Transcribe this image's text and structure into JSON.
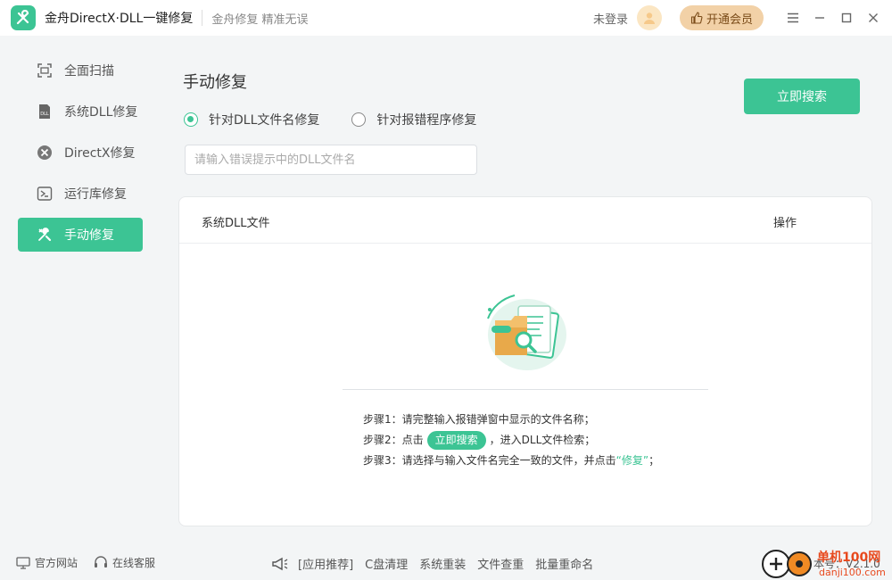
{
  "app": {
    "title": "金舟DirectX·DLL一键修复",
    "slogan": "金舟修复 精准无误",
    "login": "未登录",
    "vip": "开通会员"
  },
  "sidebar": {
    "items": [
      {
        "label": "全面扫描",
        "icon": "scan-icon"
      },
      {
        "label": "系统DLL修复",
        "icon": "dll-icon"
      },
      {
        "label": "DirectX修复",
        "icon": "directx-icon"
      },
      {
        "label": "运行库修复",
        "icon": "runtime-icon"
      },
      {
        "label": "手动修复",
        "icon": "wrench-icon",
        "active": true
      }
    ]
  },
  "main": {
    "title": "手动修复",
    "radio_by_name": "针对DLL文件名修复",
    "radio_by_program": "针对报错程序修复",
    "search_placeholder": "请输入错误提示中的DLL文件名",
    "search_button": "立即搜索",
    "table": {
      "col_file": "系统DLL文件",
      "col_op": "操作"
    },
    "steps": {
      "step1": "步骤1：请完整输入报错弹窗中显示的文件名称；",
      "step2_pre": "步骤2：点击",
      "step2_chip": "立即搜索",
      "step2_post": "，进入DLL文件检索；",
      "step3_pre": "步骤3：请选择与输入文件名完全一致的文件，并点击",
      "step3_hl": "“修复”",
      "step3_post": "；"
    }
  },
  "footer": {
    "website": "官方网站",
    "service": "在线客服",
    "rec_label": "[应用推荐]",
    "rec_items": [
      "C盘清理",
      "系统重装",
      "文件查重",
      "批量重命名"
    ],
    "version": "本号：V2.1.0"
  },
  "watermark": {
    "line1": "单机100网",
    "line2": "danji100.com"
  },
  "colors": {
    "accent": "#3cc494",
    "vip_bg": "#f2d1a7"
  }
}
